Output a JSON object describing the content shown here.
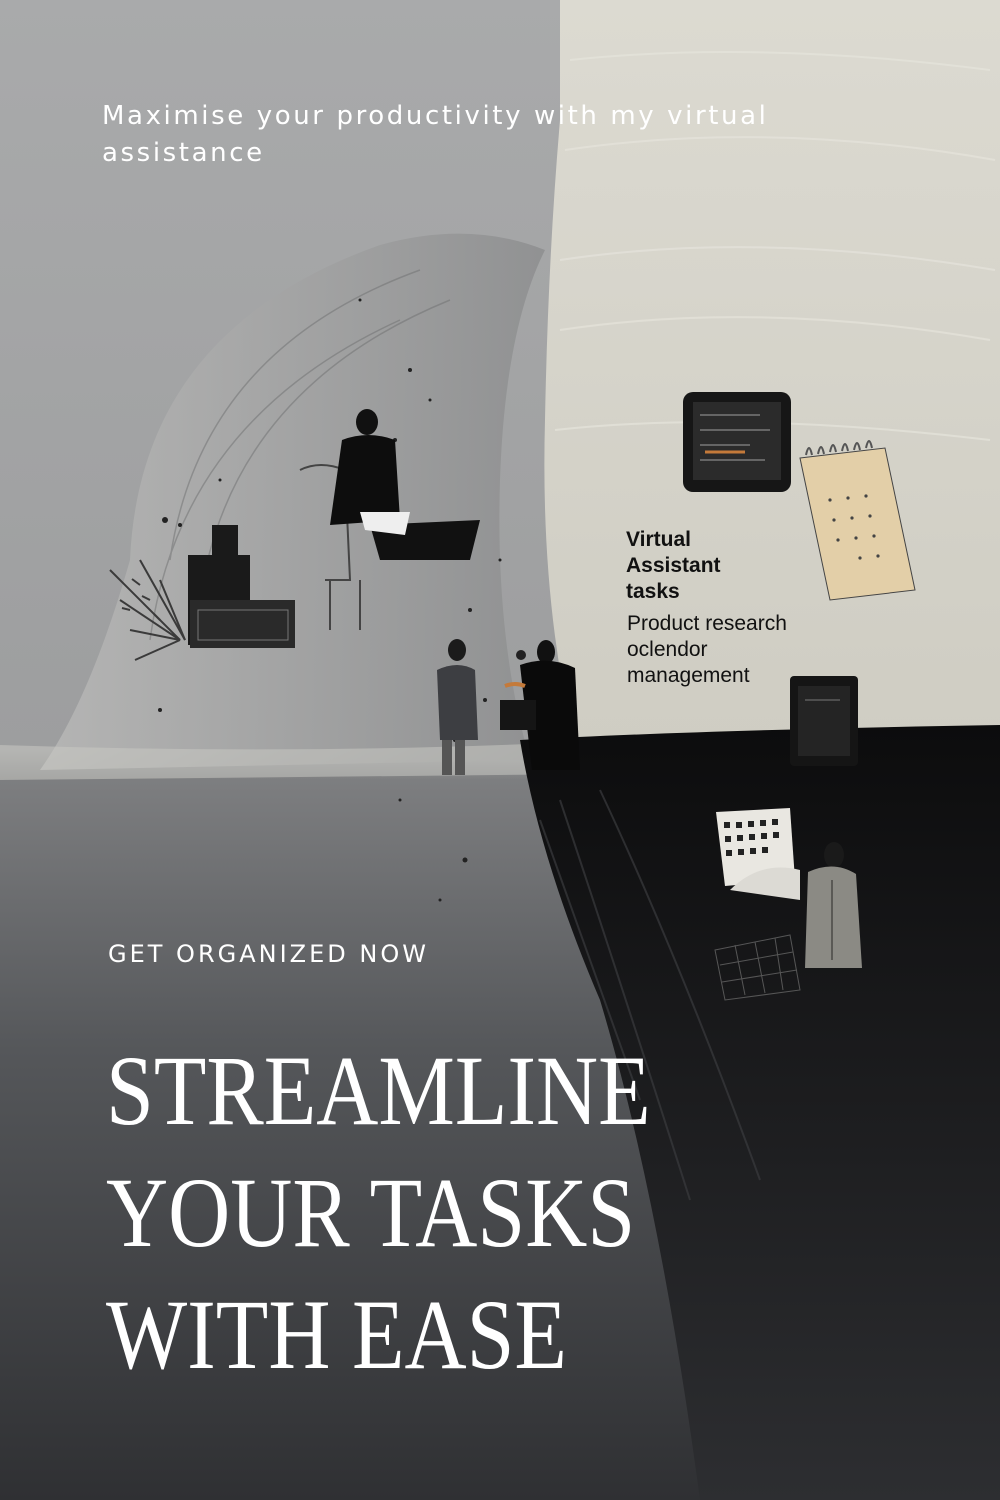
{
  "tagline": "Maximise your productivity with my virtual assistance",
  "eyebrow": "GET ORGANIZED NOW",
  "headline": [
    "STREAMLINE",
    "YOUR TASKS",
    "WITH EASE"
  ],
  "illustration": {
    "sign_title": [
      "Virtual",
      "Assistant",
      "tasks"
    ],
    "sign_items": [
      "Product research",
      "oclendor",
      "management"
    ]
  },
  "colors": {
    "paper": "#d8d6cc",
    "ink": "#111111",
    "calendar": "#e3cfa8",
    "accent": "#c47a3a"
  }
}
